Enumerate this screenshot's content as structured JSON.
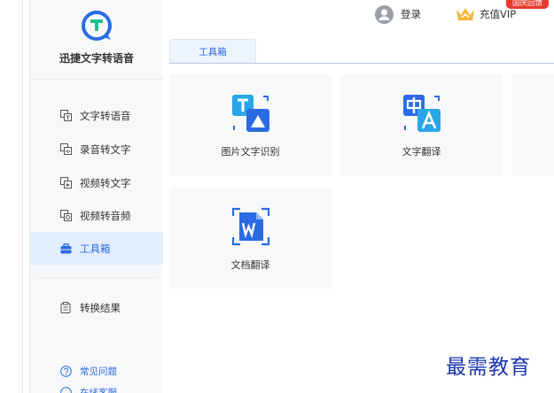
{
  "app": {
    "name": "迅捷文字转语音"
  },
  "header": {
    "login_label": "登录",
    "vip_label": "充值VIP",
    "promo_badge": "国庆回馈"
  },
  "sidebar": {
    "items": [
      {
        "label": "文字转语音",
        "icon": "text-to-speech-icon",
        "active": false
      },
      {
        "label": "录音转文字",
        "icon": "audio-to-text-icon",
        "active": false
      },
      {
        "label": "视频转文字",
        "icon": "video-to-text-icon",
        "active": false
      },
      {
        "label": "视频转音频",
        "icon": "video-to-audio-icon",
        "active": false
      },
      {
        "label": "工具箱",
        "icon": "toolbox-icon",
        "active": true
      }
    ],
    "result": {
      "label": "转换结果",
      "icon": "clipboard-icon"
    },
    "links": [
      {
        "label": "常见问题",
        "icon": "question-circle-icon"
      },
      {
        "label": "在线客服",
        "icon": "chat-icon"
      }
    ]
  },
  "tabs": [
    {
      "label": "工具箱",
      "active": true
    }
  ],
  "tools": [
    {
      "label": "图片文字识别",
      "icon": "image-text-recognition-icon"
    },
    {
      "label": "文字翻译",
      "icon": "text-translate-icon"
    },
    {
      "label": "文档翻译",
      "icon": "document-translate-icon"
    }
  ],
  "watermark": "最需教育",
  "colors": {
    "accent": "#2a6be4",
    "active_bg": "#e3eefc",
    "card_bg": "#f7f8fa",
    "promo": "#e8392d",
    "crown": "#f4b73a"
  }
}
